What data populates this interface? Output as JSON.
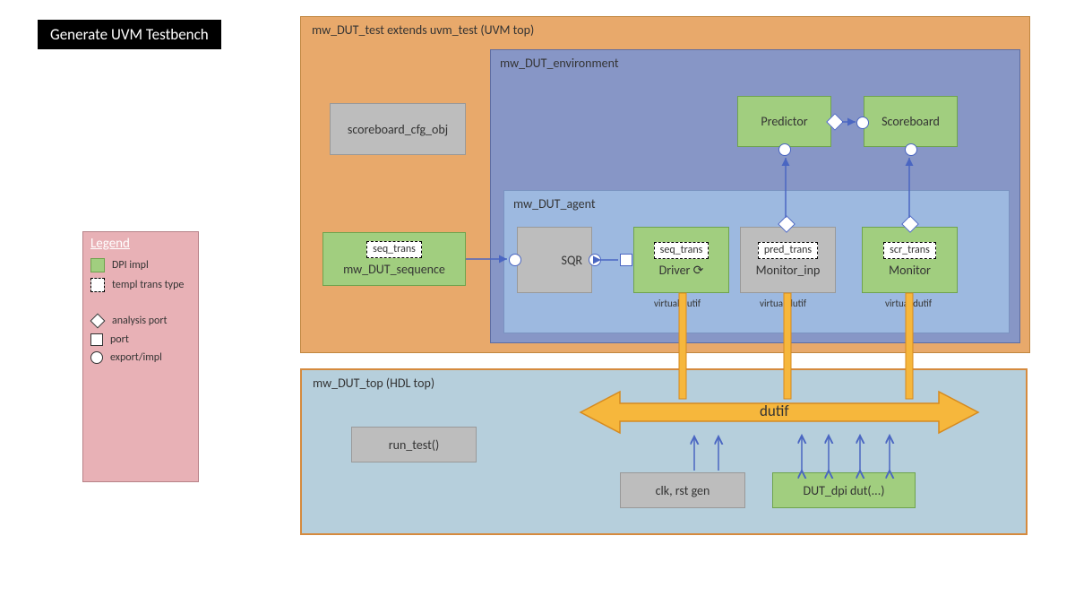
{
  "title": "Generate UVM Testbench",
  "uvm_top": {
    "label": "mw_DUT_test extends uvm_test (UVM top)",
    "scoreboard_cfg": "scoreboard_cfg_obj",
    "sequence": {
      "name": "mw_DUT_sequence",
      "trans": "seq_trans"
    },
    "environment": {
      "label": "mw_DUT_environment",
      "predictor": "Predictor",
      "scoreboard": "Scoreboard",
      "agent": {
        "label": "mw_DUT_agent",
        "sqr": "SQR",
        "driver": {
          "name": "Driver",
          "trans": "seq_trans",
          "vif": "virtual dutif"
        },
        "monitor_inp": {
          "name": "Monitor_inp",
          "trans": "pred_trans",
          "vif": "virtual dutif"
        },
        "monitor": {
          "name": "Monitor",
          "trans": "scr_trans",
          "vif": "virtual dutif"
        }
      }
    }
  },
  "hdl_top": {
    "label": "mw_DUT_top (HDL top)",
    "run_test": "run_test()",
    "clk_rst": "clk, rst gen",
    "dut": "DUT_dpi dut(...)",
    "dutif": "dutif"
  },
  "legend": {
    "title": "Legend",
    "dpi_impl": "DPI impl",
    "templ_trans": "templ trans type",
    "analysis_port": "analysis port",
    "port": "port",
    "export_impl": "export/impl"
  }
}
